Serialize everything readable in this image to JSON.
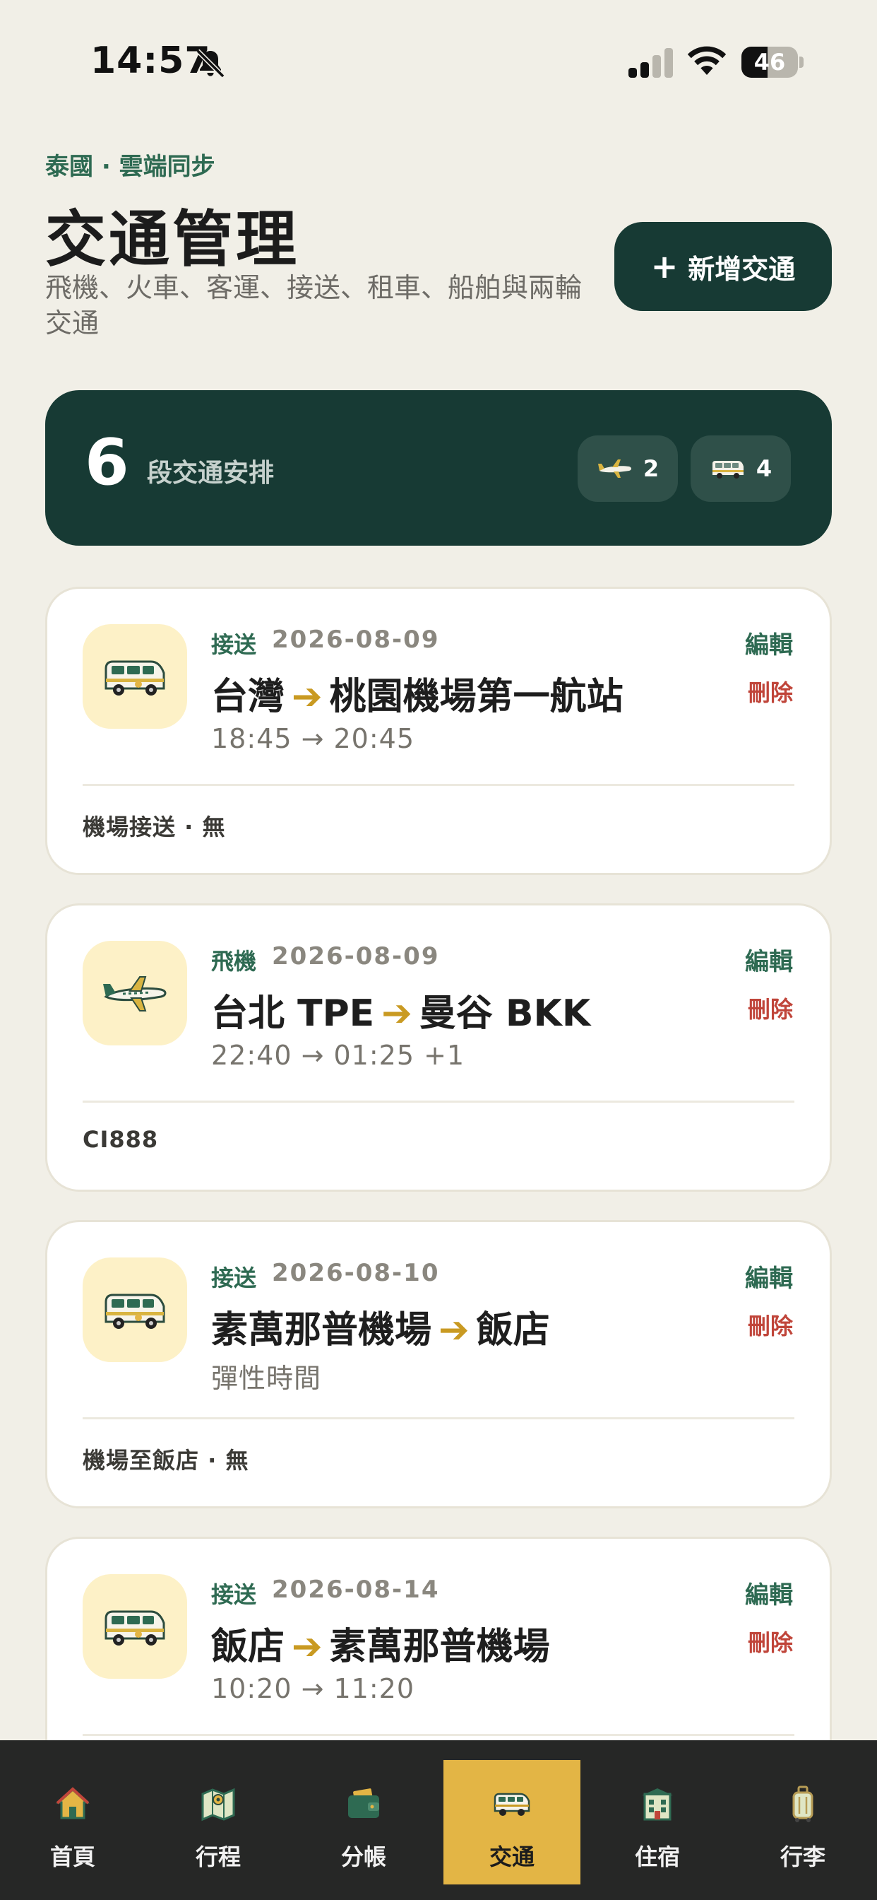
{
  "status_bar": {
    "time": "14:57",
    "battery_level": "46",
    "battery_fraction": 0.46,
    "icons": [
      "bell-slash-icon",
      "signal-icon",
      "wifi-icon",
      "battery-icon"
    ]
  },
  "header": {
    "eyebrow": "泰國 · 雲端同步",
    "title": "交通管理",
    "subtitle": "飛機、火車、客運、接送、租車、船舶與兩輪交通",
    "add_button_label": "新增交通",
    "add_button_icon": "plus-icon"
  },
  "summary": {
    "count": "6",
    "label": "段交通安排",
    "chips": [
      {
        "icon": "airplane-icon",
        "count": "2"
      },
      {
        "icon": "van-icon",
        "count": "4"
      }
    ]
  },
  "colors": {
    "accent_dark": "#173a34",
    "accent_green": "#2e6a52",
    "arrow_gold": "#c99a22",
    "delete_red": "#c0453a",
    "active_tab": "#e3b545",
    "tab_bar": "#262726"
  },
  "cards": [
    {
      "icon": "van-icon",
      "type": "接送",
      "date": "2026-08-09",
      "from": "台灣",
      "arrow": "➔",
      "to": "桃園機場第一航站",
      "time": "18:45 → 20:45",
      "note": "機場接送 · 無",
      "edit": "編輯",
      "delete": "刪除"
    },
    {
      "icon": "airplane-icon",
      "type": "飛機",
      "date": "2026-08-09",
      "from": "台北 TPE",
      "arrow": "➔",
      "to": "曼谷 BKK",
      "time": "22:40 → 01:25 +1",
      "note": "CI888",
      "edit": "編輯",
      "delete": "刪除"
    },
    {
      "icon": "van-icon",
      "type": "接送",
      "date": "2026-08-10",
      "from": "素萬那普機場",
      "arrow": "➔",
      "to": "飯店",
      "time": "彈性時間",
      "note": "機場至飯店 · 無",
      "edit": "編輯",
      "delete": "刪除"
    },
    {
      "icon": "van-icon",
      "type": "接送",
      "date": "2026-08-14",
      "from": "飯店",
      "arrow": "➔",
      "to": "素萬那普機場",
      "time": "10:20 → 11:20",
      "note": "",
      "edit": "編輯",
      "delete": "刪除"
    }
  ],
  "tab_bar": {
    "active": "交通",
    "items": [
      {
        "label": "首頁",
        "icon": "home-icon"
      },
      {
        "label": "行程",
        "icon": "map-icon"
      },
      {
        "label": "分帳",
        "icon": "wallet-icon"
      },
      {
        "label": "交通",
        "icon": "van-icon"
      },
      {
        "label": "住宿",
        "icon": "hotel-icon"
      },
      {
        "label": "行李",
        "icon": "luggage-icon"
      }
    ]
  }
}
